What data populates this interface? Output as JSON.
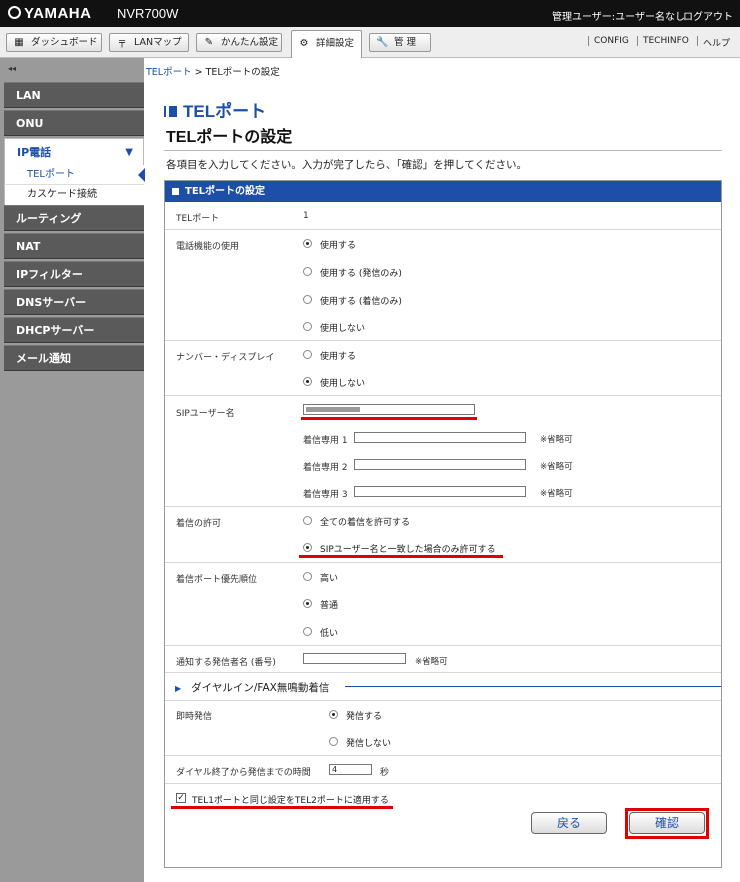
{
  "header": {
    "brand": "YAMAHA",
    "model": "NVR700W",
    "user_info": "管理ユーザー:ユーザー名なし",
    "logout": "ログアウト"
  },
  "toolbar": {
    "tabs": [
      {
        "label": "ダッシュボード",
        "icon": "dashboard-icon"
      },
      {
        "label": "LANマップ",
        "icon": "lan-map-icon"
      },
      {
        "label": "かんたん設定",
        "icon": "wand-icon"
      },
      {
        "label": "詳細設定",
        "icon": "gear-icon",
        "active": true
      },
      {
        "label": "管 理",
        "icon": "wrench-icon"
      }
    ],
    "links": [
      "CONFIG",
      "TECHINFO",
      "ヘルプ"
    ]
  },
  "sidebar": {
    "collapse": "◂◂",
    "items": [
      {
        "label": "LAN"
      },
      {
        "label": "ONU"
      },
      {
        "label": "IP電話",
        "open": true,
        "sub": [
          "TELポート",
          "カスケード接続"
        ]
      },
      {
        "label": "ルーティング"
      },
      {
        "label": "NAT"
      },
      {
        "label": "IPフィルター"
      },
      {
        "label": "DNSサーバー"
      },
      {
        "label": "DHCPサーバー"
      },
      {
        "label": "メール通知"
      }
    ]
  },
  "breadcrumb": {
    "link": "TELポート",
    "sep": " > ",
    "current": "TELポートの設定"
  },
  "page": {
    "section_title": "TELポート",
    "title": "TELポートの設定",
    "instructions": "各項目を入力してください。入力が完了したら、「確認」を押してください。"
  },
  "form": {
    "panel_title": "TELポートの設定",
    "tel_port": {
      "label": "TELポート",
      "value": "1"
    },
    "phone_function": {
      "label": "電話機能の使用",
      "options": [
        "使用する",
        "使用する (発信のみ)",
        "使用する (着信のみ)",
        "使用しない"
      ],
      "selected": 0
    },
    "number_display": {
      "label": "ナンバー・ディスプレイ",
      "options": [
        "使用する",
        "使用しない"
      ],
      "selected": 1
    },
    "sip_user": {
      "label": "SIPユーザー名",
      "value": "",
      "dedicated": [
        {
          "label": "着信専用 1",
          "value": "",
          "note": "※省略可"
        },
        {
          "label": "着信専用 2",
          "value": "",
          "note": "※省略可"
        },
        {
          "label": "着信専用 3",
          "value": "",
          "note": "※省略可"
        }
      ]
    },
    "incoming_permission": {
      "label": "着信の許可",
      "options": [
        "全ての着信を許可する",
        "SIPユーザー名と一致した場合のみ許可する"
      ],
      "selected": 1
    },
    "priority": {
      "label": "着信ポート優先順位",
      "options": [
        "高い",
        "普通",
        "低い"
      ],
      "selected": 1
    },
    "caller_name": {
      "label": "通知する発信者名 (番号)",
      "value": "",
      "note": "※省略可"
    },
    "dialin_section": "ダイヤルイン/FAX無鳴動着信",
    "immediate_call": {
      "label": "即時発信",
      "options": [
        "発信する",
        "発信しない"
      ],
      "selected": 0
    },
    "dial_wait": {
      "label": "ダイヤル終了から発信までの時間",
      "value": "4",
      "unit": "秒"
    },
    "apply_tel2": {
      "label": "TEL1ポートと同じ設定をTEL2ポートに適用する",
      "checked": true
    }
  },
  "buttons": {
    "back": "戻る",
    "confirm": "確認"
  },
  "colors": {
    "accent": "#1e4fa8",
    "highlight": "#e00000",
    "topbar": "#111111",
    "sidebar": "#9a9a9a"
  }
}
